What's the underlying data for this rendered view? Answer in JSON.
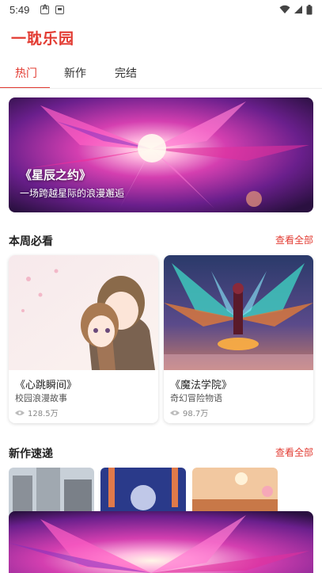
{
  "status_bar": {
    "time": "5:49",
    "icons_left": [
      "a-notification-icon",
      "media-notification-icon"
    ],
    "icons_right": [
      "wifi-icon",
      "signal-icon",
      "battery-icon"
    ]
  },
  "app": {
    "title": "一耽乐园",
    "accent_color": "#e23b32"
  },
  "tabs": [
    {
      "label": "热门",
      "active": true
    },
    {
      "label": "新作",
      "active": false
    },
    {
      "label": "完结",
      "active": false
    }
  ],
  "banner": {
    "title": "《星辰之约》",
    "subtitle": "一场跨越星际的浪漫邂逅"
  },
  "weekly": {
    "title": "本周必看",
    "more_label": "查看全部",
    "cards": [
      {
        "title": "《心跳瞬间》",
        "desc": "校园浪漫故事",
        "views": "128.5万"
      },
      {
        "title": "《魔法学院》",
        "desc": "奇幻冒险物语",
        "views": "98.7万"
      }
    ]
  },
  "new_releases": {
    "title": "新作速递",
    "more_label": "查看全部"
  }
}
